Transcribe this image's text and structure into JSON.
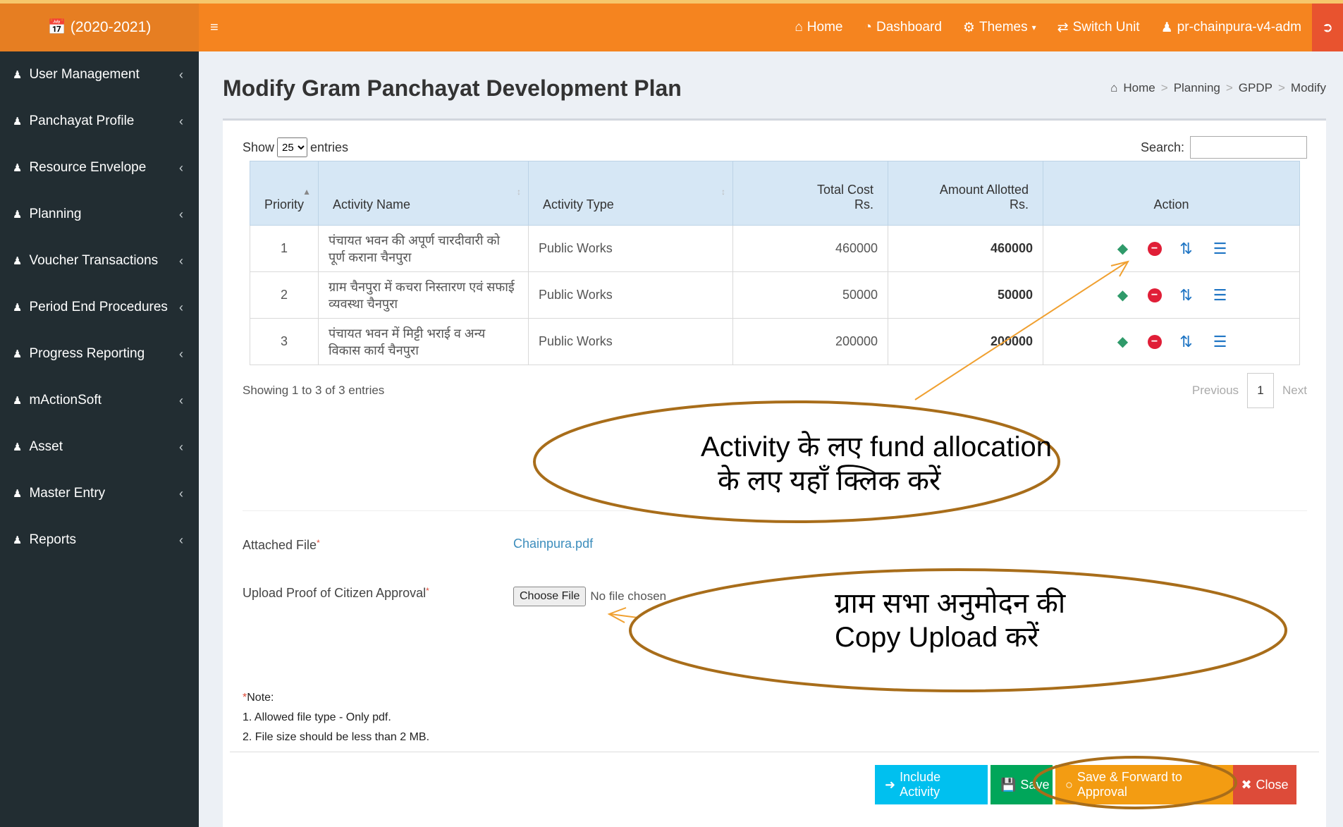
{
  "brand": {
    "year_label": "(2020-2021)"
  },
  "navbar": {
    "menu_icon": "hamburger-icon",
    "links": [
      {
        "label": "Home",
        "icon": "home-icon"
      },
      {
        "label": "Dashboard",
        "icon": "dashboard-icon"
      },
      {
        "label": "Themes",
        "icon": "gears-icon"
      },
      {
        "label": "Switch Unit",
        "icon": "exchange-icon"
      },
      {
        "label": "pr-chainpura-v4-adm",
        "icon": "user-icon"
      }
    ]
  },
  "sidebar": {
    "items": [
      {
        "label": "User Management"
      },
      {
        "label": "Panchayat Profile"
      },
      {
        "label": "Resource Envelope"
      },
      {
        "label": "Planning"
      },
      {
        "label": "Voucher Transactions"
      },
      {
        "label": "Period End Procedures"
      },
      {
        "label": "Progress Reporting"
      },
      {
        "label": "mActionSoft"
      },
      {
        "label": "Asset"
      },
      {
        "label": "Master Entry"
      },
      {
        "label": "Reports"
      }
    ]
  },
  "page": {
    "title": "Modify Gram Panchayat Development Plan",
    "breadcrumb": [
      "Home",
      "Planning",
      "GPDP",
      "Modify"
    ]
  },
  "table_controls": {
    "show_label": "Show",
    "entries_value": "25",
    "entries_label": "entries",
    "search_label": "Search:",
    "search_value": ""
  },
  "table": {
    "headers": {
      "priority": "Priority",
      "activity_name": "Activity Name",
      "activity_type": "Activity Type",
      "total_cost_1": "Total Cost",
      "total_cost_2": "Rs.",
      "amount_1": "Amount Allotted",
      "amount_2": "Rs.",
      "action": "Action"
    },
    "rows": [
      {
        "priority": "1",
        "name": "पंचायत भवन की अपूर्ण चारदीवारी को पूर्ण कराना चैनपुरा",
        "type": "Public Works",
        "total": "460000",
        "allotted": "460000"
      },
      {
        "priority": "2",
        "name": "ग्राम चैनपुरा में कचरा निस्तारण एवं सफाई व्यवस्था चैनपुरा",
        "type": "Public Works",
        "total": "50000",
        "allotted": "50000"
      },
      {
        "priority": "3",
        "name": "पंचायत भवन में मिट्टी भराई व अन्य विकास कार्य चैनपुरा",
        "type": "Public Works",
        "total": "200000",
        "allotted": "200000"
      }
    ],
    "action_icons": [
      "money-icon",
      "delete-icon",
      "change-icon",
      "details-icon"
    ]
  },
  "table_footer": {
    "info": "Showing 1 to 3 of 3 entries",
    "previous": "Previous",
    "page": "1",
    "next": "Next"
  },
  "form": {
    "attached_label": "Attached File",
    "attached_file": "Chainpura.pdf",
    "upload_label": "Upload Proof of Citizen Approval",
    "choose_btn": "Choose File",
    "no_file": "No file chosen",
    "note_title": "Note:",
    "note_1": "1. Allowed file type - Only pdf.",
    "note_2": "2. File size should be less than 2 MB."
  },
  "buttons": {
    "include": "Include Activity",
    "save": "Save",
    "forward": "Save & Forward to Approval",
    "close": "Close"
  },
  "annotations": {
    "callout_1_line1": "Activity के   लए  fund allocation",
    "callout_1_line2": "के  लए  यहाँ  क्लिक  करें",
    "callout_2_line1": "ग्राम  सभा  अनुमोदन  की",
    "callout_2_line2": "Copy Upload करें",
    "callout_color": "#a86d1a",
    "arrow_color": "#f0a030"
  }
}
